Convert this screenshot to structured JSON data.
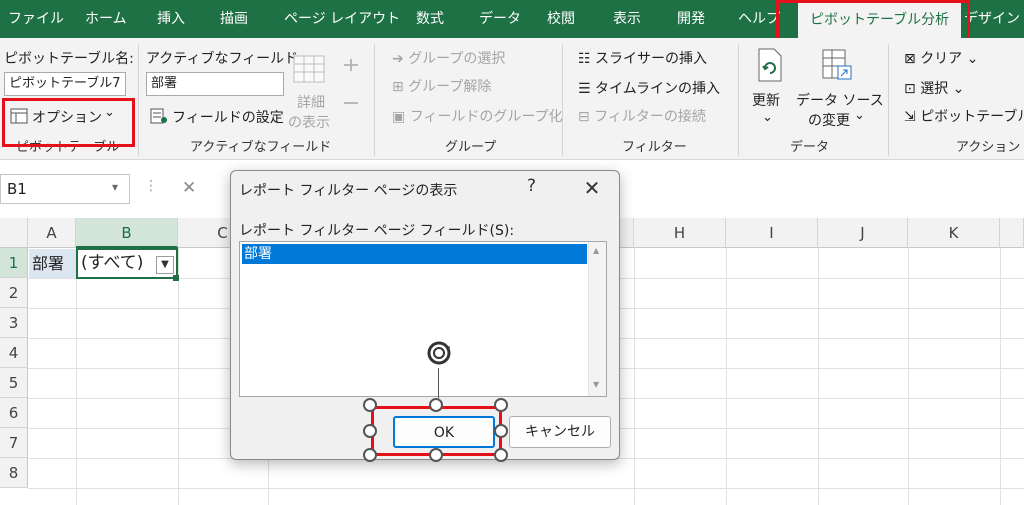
{
  "tabs": [
    {
      "label": "ファイル",
      "active": false
    },
    {
      "label": "ホーム",
      "active": false
    },
    {
      "label": "挿入",
      "active": false
    },
    {
      "label": "描画",
      "active": false
    },
    {
      "label": "ページ レイアウト",
      "active": false
    },
    {
      "label": "数式",
      "active": false
    },
    {
      "label": "データ",
      "active": false
    },
    {
      "label": "校閲",
      "active": false
    },
    {
      "label": "表示",
      "active": false
    },
    {
      "label": "開発",
      "active": false
    },
    {
      "label": "ヘルプ",
      "active": false
    },
    {
      "label": "ピボットテーブル分析",
      "active": true
    },
    {
      "label": "デザイン",
      "active": false
    }
  ],
  "ribbon": {
    "pivot_name_label": "ピボットテーブル名:",
    "pivot_name_value": "ピボットテーブル7",
    "options_label": "オプション",
    "group_pivottable": "ピボットテーブル",
    "active_field_label": "アクティブなフィールド:",
    "active_field_value": "部署",
    "field_settings_label": "フィールドの設定",
    "drilldown_label_1": "詳細",
    "drilldown_label_2": "の表示",
    "group_active_field": "アクティブなフィールド",
    "group_selection_label": "グループの選択",
    "ungroup_label": "グループ解除",
    "group_field_label": "フィールドのグループ化",
    "group_group": "グループ",
    "insert_slicer_label": "スライサーの挿入",
    "insert_timeline_label": "タイムラインの挿入",
    "filter_connections_label": "フィルターの接続",
    "group_filter": "フィルター",
    "refresh_label": "更新",
    "change_source_label_1": "データ ソース",
    "change_source_label_2": "の変更",
    "group_data": "データ",
    "clear_label": "クリア",
    "select_label": "選択",
    "move_pivot_label": "ピボットテーブルの",
    "group_actions": "アクション"
  },
  "formula_bar": {
    "name_box": "B1",
    "cancel_symbol": "✕"
  },
  "grid": {
    "columns": [
      "A",
      "B",
      "C",
      "H",
      "I",
      "J",
      "K"
    ],
    "rows": [
      "1",
      "2",
      "3",
      "4",
      "5",
      "6",
      "7",
      "8"
    ],
    "cell_a1": "部署",
    "cell_b1": "(すべて)"
  },
  "dialog": {
    "title": "レポート フィルター ページの表示",
    "help": "?",
    "close": "✕",
    "field_label": "レポート フィルター ページ フィールド(S):",
    "list_items": [
      "部署"
    ],
    "ok_label": "OK",
    "cancel_label": "キャンセル"
  },
  "colors": {
    "excel_green": "#1e7145",
    "annotation_red": "#e4101a",
    "selection_blue": "#0078d7"
  }
}
